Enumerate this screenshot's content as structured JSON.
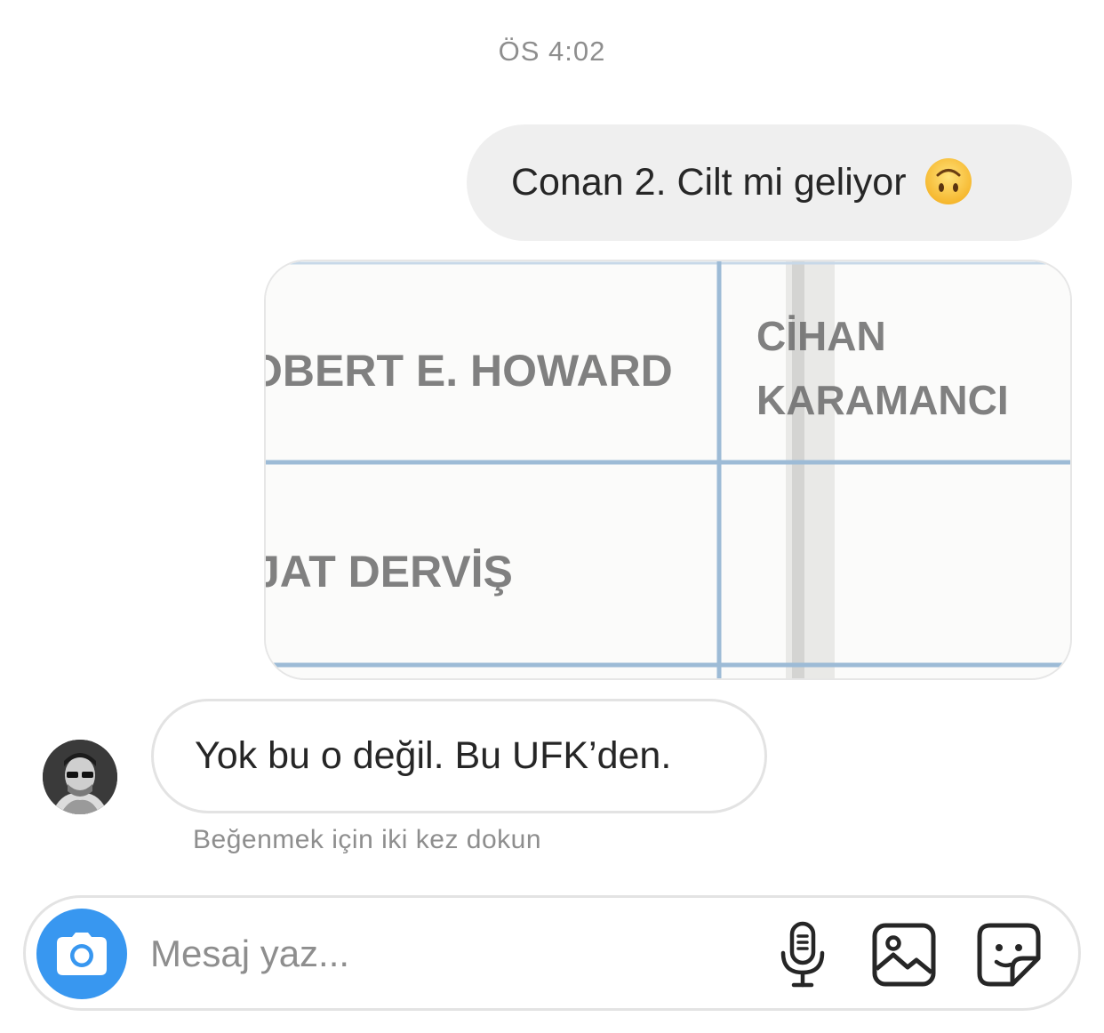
{
  "thread": {
    "timestamp": "ÖS 4:02",
    "outgoing_message": "Conan 2. Cilt mi geliyor",
    "outgoing_emoji": "upside-down-face",
    "shared_image": {
      "row1_left": "OBERT E. HOWARD",
      "row1_right_line1": "CİHAN",
      "row1_right_line2": "KARAMANCI",
      "row2_left": "JAT DERVİŞ"
    },
    "incoming_message": "Yok bu o değil. Bu UFK’den.",
    "hint": "Beğenmek için iki kez dokun"
  },
  "composer": {
    "placeholder": "Mesaj yaz...",
    "camera_icon": "camera-icon",
    "mic_icon": "microphone-icon",
    "gallery_icon": "gallery-icon",
    "sticker_icon": "sticker-icon"
  },
  "colors": {
    "accent": "#3897f0",
    "bubble_gray": "#efefef",
    "meta_text": "#8e8e8e",
    "table_line": "#9dbbd6"
  }
}
